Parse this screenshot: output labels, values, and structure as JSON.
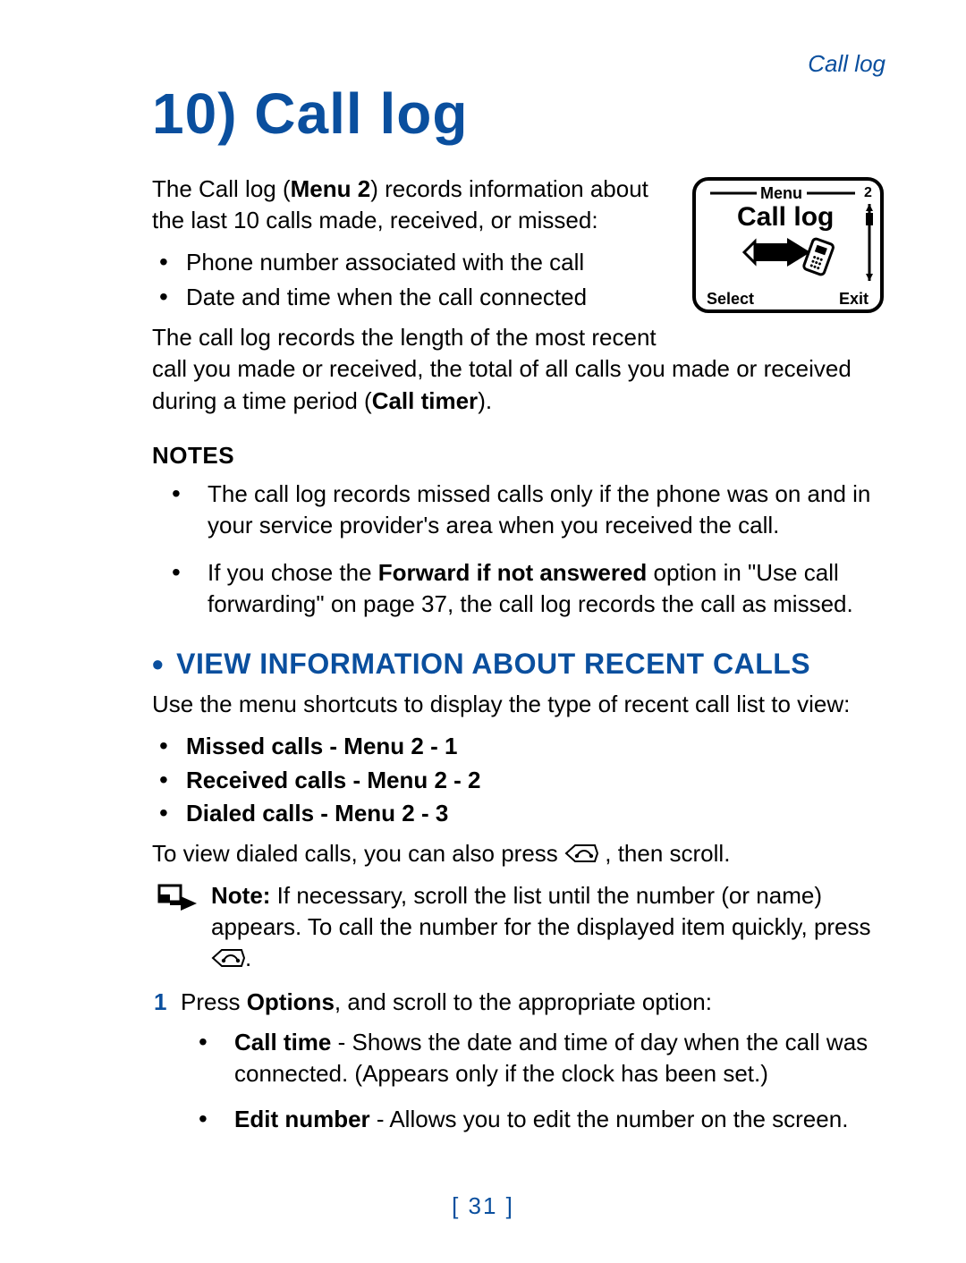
{
  "header": {
    "running_head": "Call log"
  },
  "chapter": {
    "title": "10) Call log"
  },
  "intro": {
    "p1_pre": "The Call log (",
    "p1_bold": "Menu 2",
    "p1_post": ") records information about the last 10 calls made, received, or missed:",
    "bullets": [
      "Phone number associated with the call",
      "Date and time when the call connected"
    ],
    "p2_pre": "The call log records the length of the most recent call you made or received, the total of all calls you made or received during a time period (",
    "p2_bold": "Call timer",
    "p2_post": ")."
  },
  "notes": {
    "label": "NOTES",
    "items": [
      {
        "text_pre": "The call log records missed calls only if the phone was on and in your service provider's area when you received the call.",
        "bold": "",
        "text_post": ""
      },
      {
        "text_pre": "If you chose the ",
        "bold": "Forward if not answered ",
        "text_post": "option in \"Use call forwarding\" on page 37, the call log records the call as missed."
      }
    ]
  },
  "section_view": {
    "heading": "VIEW INFORMATION ABOUT RECENT CALLS",
    "intro": "Use the menu shortcuts to display the type of recent call list to view:",
    "menu_items": [
      "Missed calls - Menu 2 - 1",
      "Received calls - Menu 2 - 2",
      "Dialed calls - Menu 2 - 3"
    ],
    "after_pre": "To view dialed calls, you can also press ",
    "after_post": ", then scroll.",
    "note": {
      "label": "Note:",
      "body_pre": " If necessary, scroll the list until the number (or name) appears. To call the number for the displayed item quickly, press ",
      "body_post": "."
    },
    "step1_pre": "Press ",
    "step1_bold": "Options",
    "step1_post": ", and scroll to the appropriate option:",
    "options": [
      {
        "bold": "Call time",
        "text": " - Shows the date and time of day when the call was connected. (Appears only if the clock has been set.)"
      },
      {
        "bold": "Edit number",
        "text": " - Allows you to edit the number on the screen."
      }
    ]
  },
  "phone_screen": {
    "menu_label": "Menu",
    "index": "2",
    "title": "Call log",
    "left_softkey": "Select",
    "right_softkey": "Exit"
  },
  "page_number": "[ 31 ]"
}
